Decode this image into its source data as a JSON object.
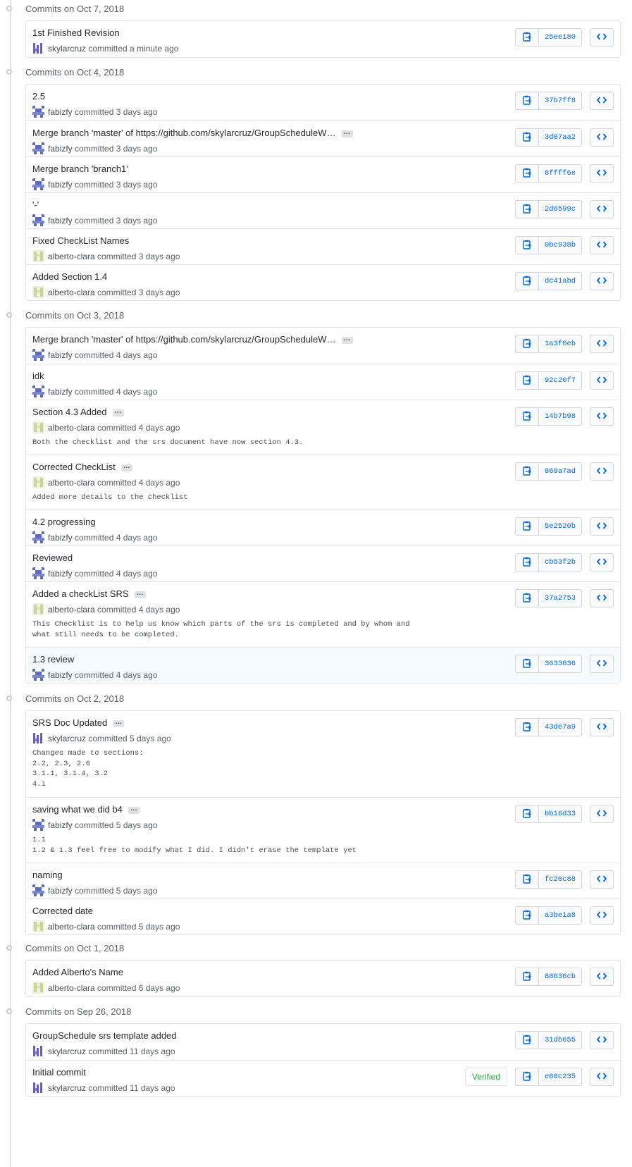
{
  "colors": {
    "link": "#0366d6",
    "muted": "#586069",
    "border": "#e1e4e8",
    "verified": "#28a745",
    "highlight_row": "#f6fbff"
  },
  "groups": [
    {
      "title": "Commits on Oct 7, 2018",
      "commits": [
        {
          "title": "1st Finished Revision",
          "author": "skylarcruz",
          "avatar": "skylarcruz",
          "meta": "committed a minute ago",
          "sha": "25ee180"
        }
      ]
    },
    {
      "title": "Commits on Oct 4, 2018",
      "commits": [
        {
          "title": "2.5",
          "author": "fabizfy",
          "avatar": "fabizfy",
          "meta": "committed 3 days ago",
          "sha": "37b7ff8"
        },
        {
          "title": "Merge branch 'master' of https://github.com/skylarcruz/GroupScheduleW…",
          "author": "fabizfy",
          "avatar": "fabizfy",
          "meta": "committed 3 days ago",
          "sha": "3d07aa2",
          "ellipsis": true
        },
        {
          "title": "Merge branch 'branch1'",
          "author": "fabizfy",
          "avatar": "fabizfy",
          "meta": "committed 3 days ago",
          "sha": "8ffff6e"
        },
        {
          "title": "'-'",
          "author": "fabizfy",
          "avatar": "fabizfy",
          "meta": "committed 3 days ago",
          "sha": "2d6599c"
        },
        {
          "title": "Fixed CheckList Names",
          "author": "alberto-clara",
          "avatar": "alberto-clara",
          "meta": "committed 3 days ago",
          "sha": "0bc938b"
        },
        {
          "title": "Added Section 1.4",
          "author": "alberto-clara",
          "avatar": "alberto-clara",
          "meta": "committed 3 days ago",
          "sha": "dc41abd"
        }
      ]
    },
    {
      "title": "Commits on Oct 3, 2018",
      "commits": [
        {
          "title": "Merge branch 'master' of https://github.com/skylarcruz/GroupScheduleW…",
          "author": "fabizfy",
          "avatar": "fabizfy",
          "meta": "committed 4 days ago",
          "sha": "1a3f0eb",
          "ellipsis": true
        },
        {
          "title": "idk",
          "author": "fabizfy",
          "avatar": "fabizfy",
          "meta": "committed 4 days ago",
          "sha": "92c20f7"
        },
        {
          "title": "Section 4.3 Added",
          "author": "alberto-clara",
          "avatar": "alberto-clara",
          "meta": "committed 4 days ago",
          "sha": "14b7b98",
          "ellipsis": true,
          "body": "Both the checklist and the srs document have now section 4.3."
        },
        {
          "title": "Corrected CheckList",
          "author": "alberto-clara",
          "avatar": "alberto-clara",
          "meta": "committed 4 days ago",
          "sha": "869a7ad",
          "ellipsis": true,
          "body": "Added more details to the checklist"
        },
        {
          "title": "4.2 progressing",
          "author": "fabizfy",
          "avatar": "fabizfy",
          "meta": "committed 4 days ago",
          "sha": "5e2520b"
        },
        {
          "title": "Reviewed",
          "author": "fabizfy",
          "avatar": "fabizfy",
          "meta": "committed 4 days ago",
          "sha": "cb53f2b"
        },
        {
          "title": "Added a checkList SRS",
          "author": "alberto-clara",
          "avatar": "alberto-clara",
          "meta": "committed 4 days ago",
          "sha": "37a2753",
          "ellipsis": true,
          "body": "This Checklist is to help us know which parts of the srs is completed and by whom and\nwhat still needs to be completed."
        },
        {
          "title": "1.3 review",
          "author": "fabizfy",
          "avatar": "fabizfy",
          "meta": "committed 4 days ago",
          "sha": "3633636",
          "highlighted": true
        }
      ]
    },
    {
      "title": "Commits on Oct 2, 2018",
      "commits": [
        {
          "title": "SRS Doc Updated",
          "author": "skylarcruz",
          "avatar": "skylarcruz",
          "meta": "committed 5 days ago",
          "sha": "43de7a9",
          "ellipsis": true,
          "body": "Changes made to sections:\n2.2, 2.3, 2.6\n3.1.1, 3.1.4, 3.2\n4.1"
        },
        {
          "title": "saving what we did b4",
          "author": "fabizfy",
          "avatar": "fabizfy",
          "meta": "committed 5 days ago",
          "sha": "bb16d33",
          "ellipsis": true,
          "body": "1.1\n1.2 & 1.3 feel free to modify what I did. I didn't erase the template yet"
        },
        {
          "title": "naming",
          "author": "fabizfy",
          "avatar": "fabizfy",
          "meta": "committed 5 days ago",
          "sha": "fc20c88"
        },
        {
          "title": "Corrected date",
          "author": "alberto-clara",
          "avatar": "alberto-clara",
          "meta": "committed 5 days ago",
          "sha": "a3be1a8"
        }
      ]
    },
    {
      "title": "Commits on Oct 1, 2018",
      "commits": [
        {
          "title": "Added Alberto's Name",
          "author": "alberto-clara",
          "avatar": "alberto-clara",
          "meta": "committed 6 days ago",
          "sha": "88636cb"
        }
      ]
    },
    {
      "title": "Commits on Sep 26, 2018",
      "commits": [
        {
          "title": "GroupSchedule srs template added",
          "author": "skylarcruz",
          "avatar": "skylarcruz",
          "meta": "committed 11 days ago",
          "sha": "31db655"
        },
        {
          "title": "Initial commit",
          "author": "skylarcruz",
          "avatar": "skylarcruz",
          "meta": "committed 11 days ago",
          "sha": "e88c235",
          "verified": "Verified"
        }
      ]
    }
  ],
  "icons": {
    "copy": "clipboard-icon",
    "browse": "code-icon"
  }
}
